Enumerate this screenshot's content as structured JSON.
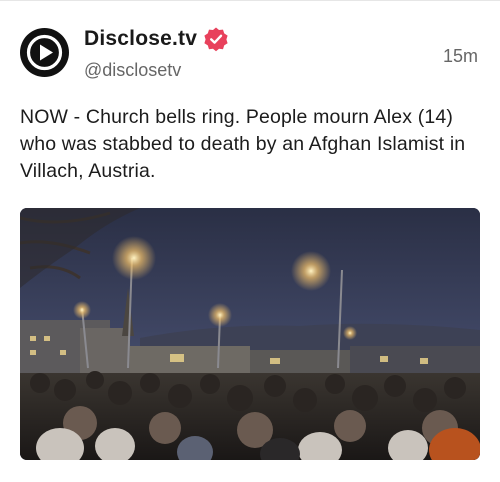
{
  "post": {
    "author": {
      "display_name": "Disclose.tv",
      "handle": "@disclosetv",
      "verified": true,
      "avatar_icon": "play-logo-icon"
    },
    "timestamp": "15m",
    "text": "NOW - Church bells ring. People mourn Alex (14) who was stabbed to death by an Afghan Islamist in Villach, Austria.",
    "media": {
      "type": "video-thumbnail"
    }
  },
  "colors": {
    "verified_badge": "#e8415c",
    "avatar_bg": "#111111",
    "text_primary": "#1c1c1c",
    "text_secondary": "#666666"
  }
}
